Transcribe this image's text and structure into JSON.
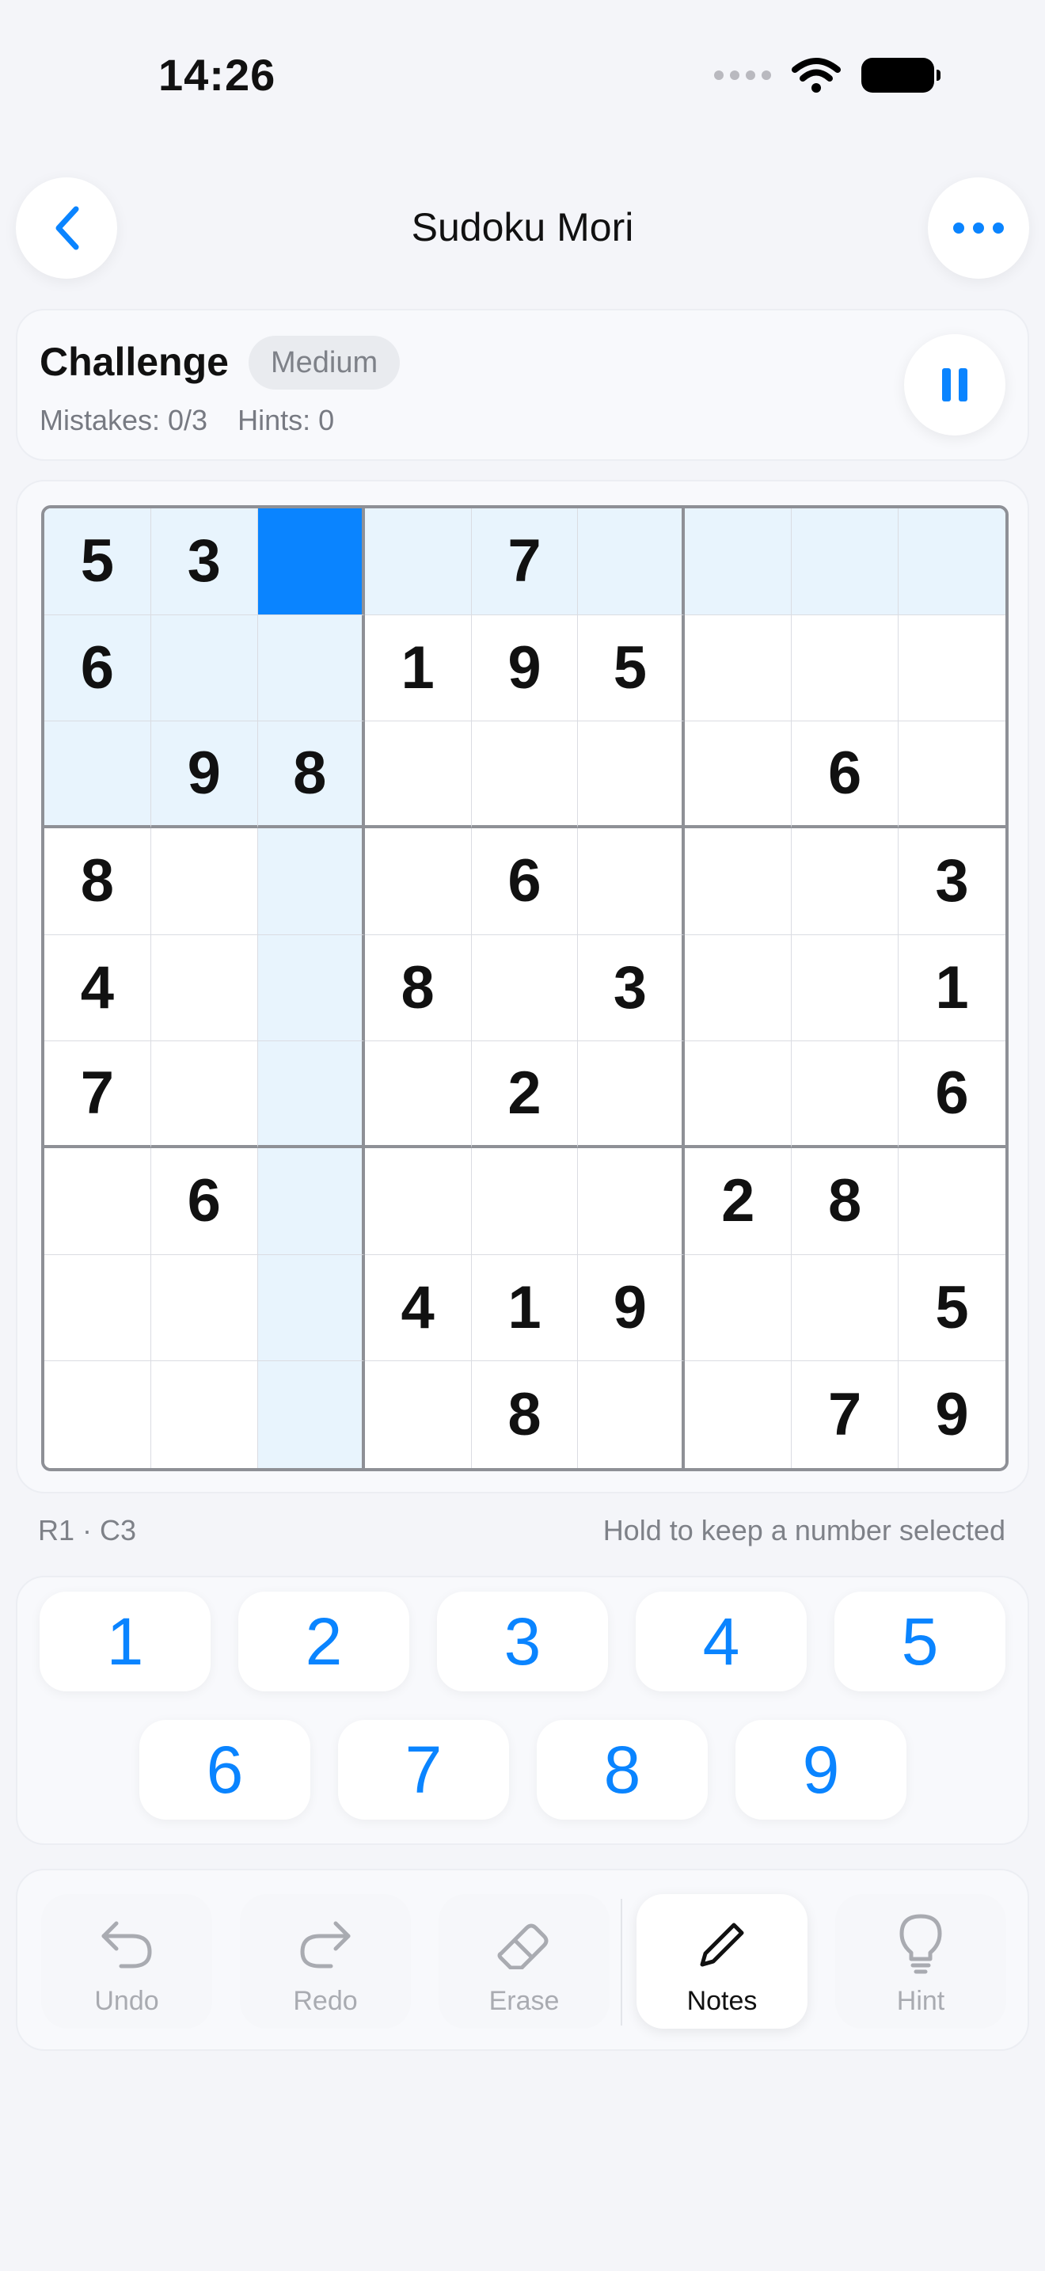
{
  "status": {
    "time": "14:26"
  },
  "nav": {
    "title": "Sudoku Mori",
    "back_icon": "chevron-left-icon",
    "more_icon": "ellipsis-icon"
  },
  "challenge": {
    "title": "Challenge",
    "difficulty": "Medium",
    "mistakes": "Mistakes: 0/3",
    "hints": "Hints: 0",
    "pause_icon": "pause-icon"
  },
  "board": {
    "selected_row": 1,
    "selected_col": 3,
    "rows": [
      [
        "5",
        "3",
        "",
        "",
        "7",
        "",
        "",
        "",
        ""
      ],
      [
        "6",
        "",
        "",
        "1",
        "9",
        "5",
        "",
        "",
        ""
      ],
      [
        "",
        "9",
        "8",
        "",
        "",
        "",
        "",
        "6",
        ""
      ],
      [
        "8",
        "",
        "",
        "",
        "6",
        "",
        "",
        "",
        "3"
      ],
      [
        "4",
        "",
        "",
        "8",
        "",
        "3",
        "",
        "",
        "1"
      ],
      [
        "7",
        "",
        "",
        "",
        "2",
        "",
        "",
        "",
        "6"
      ],
      [
        "",
        "6",
        "",
        "",
        "",
        "",
        "2",
        "8",
        ""
      ],
      [
        "",
        "",
        "",
        "4",
        "1",
        "9",
        "",
        "",
        "5"
      ],
      [
        "",
        "",
        "",
        "",
        "8",
        "",
        "",
        "7",
        "9"
      ]
    ]
  },
  "selection_info": {
    "position": "R1 · C3",
    "hint": "Hold to keep a number selected"
  },
  "numpad": [
    "1",
    "2",
    "3",
    "4",
    "5",
    "6",
    "7",
    "8",
    "9"
  ],
  "tools": {
    "undo": "Undo",
    "redo": "Redo",
    "erase": "Erase",
    "notes": "Notes",
    "hint": "Hint"
  },
  "colors": {
    "accent": "#0a84ff",
    "highlight": "#e8f4fd",
    "background": "#f4f5f9"
  }
}
